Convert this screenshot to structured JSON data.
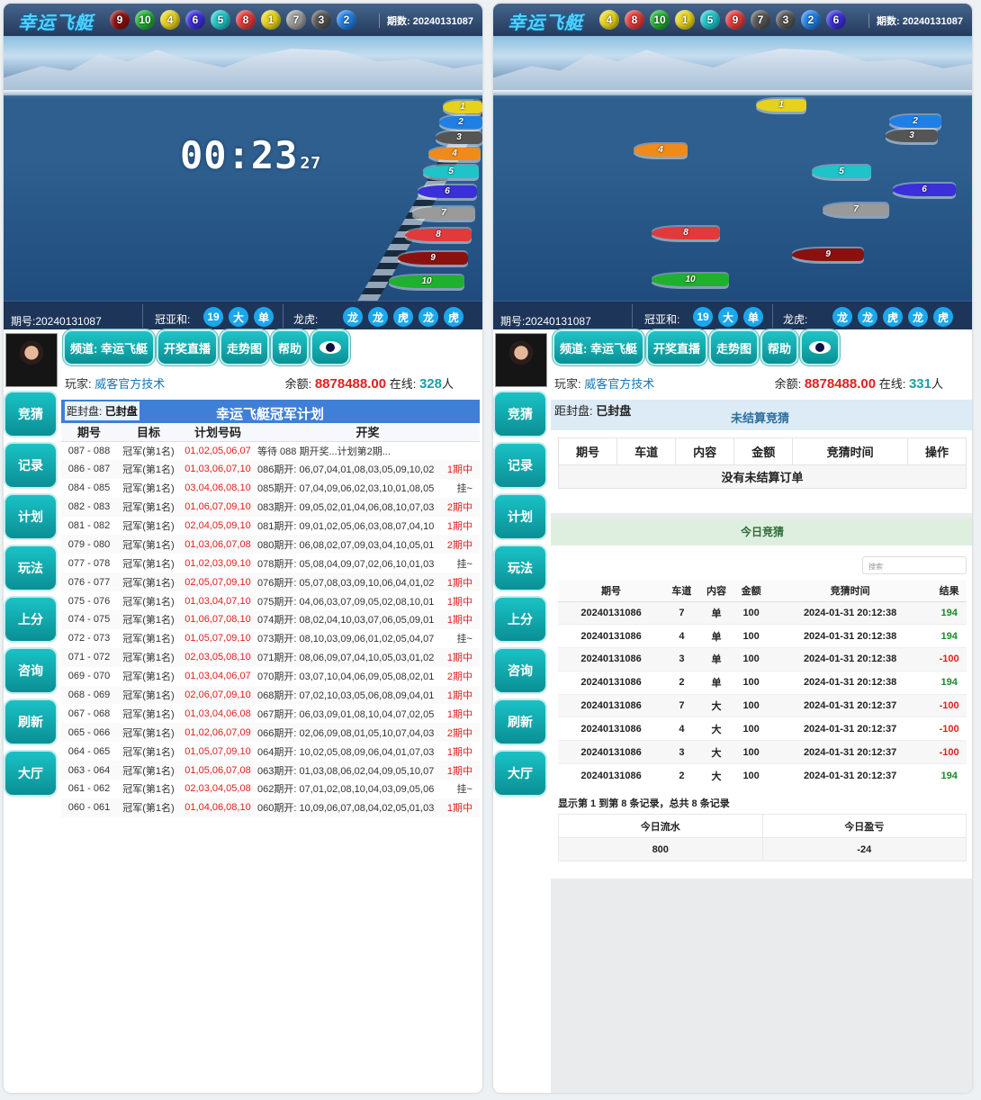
{
  "left": {
    "logo": "幸运飞艇",
    "balls": [
      "9",
      "10",
      "4",
      "6",
      "5",
      "8",
      "1",
      "7",
      "3",
      "2"
    ],
    "issue_label": "期数:",
    "issue": "20240131087",
    "timer": "00:23",
    "timer_ms": "27",
    "boats": [
      "1",
      "2",
      "3",
      "4",
      "5",
      "6",
      "7",
      "8",
      "9",
      "10"
    ],
    "info_issue": "期号:20240131087",
    "gyh_label": "冠亚和:",
    "gyh": [
      "19",
      "大",
      "单"
    ],
    "lh_label": "龙虎:",
    "lh": [
      "龙",
      "龙",
      "虎",
      "龙",
      "虎"
    ],
    "buttons": [
      "频道: 幸运飞艇",
      "开奖直播",
      "走势图",
      "帮助"
    ],
    "player_label": "玩家:",
    "player_name": "威客官方技术",
    "balance_label": "余额:",
    "balance": "8878488.00",
    "online_label": "在线:",
    "online": "328",
    "online_unit": "人",
    "sidenav": [
      "竞猜",
      "记录",
      "计划",
      "玩法",
      "上分",
      "咨询",
      "刷新",
      "大厅"
    ],
    "seal_label": "距封盘:",
    "seal_value": "已封盘",
    "plan_title": "幸运飞艇冠军计划",
    "plan_headers": [
      "期号",
      "目标",
      "计划号码",
      "开奖"
    ],
    "plan_rows": [
      [
        "087 - 088",
        "冠军(第1名)",
        "01,02,05,06,07",
        "等待 088 期开奖...计划第2期...",
        ""
      ],
      [
        "086 - 087",
        "冠军(第1名)",
        "01,03,06,07,10",
        "086期开: 06,07,04,01,08,03,05,09,10,02",
        "1期中"
      ],
      [
        "084 - 085",
        "冠军(第1名)",
        "03,04,06,08,10",
        "085期开: 07,04,09,06,02,03,10,01,08,05",
        "挂~"
      ],
      [
        "082 - 083",
        "冠军(第1名)",
        "01,06,07,09,10",
        "083期开: 09,05,02,01,04,06,08,10,07,03",
        "2期中"
      ],
      [
        "081 - 082",
        "冠军(第1名)",
        "02,04,05,09,10",
        "081期开: 09,01,02,05,06,03,08,07,04,10",
        "1期中"
      ],
      [
        "079 - 080",
        "冠军(第1名)",
        "01,03,06,07,08",
        "080期开: 06,08,02,07,09,03,04,10,05,01",
        "2期中"
      ],
      [
        "077 - 078",
        "冠军(第1名)",
        "01,02,03,09,10",
        "078期开: 05,08,04,09,07,02,06,10,01,03",
        "挂~"
      ],
      [
        "076 - 077",
        "冠军(第1名)",
        "02,05,07,09,10",
        "076期开: 05,07,08,03,09,10,06,04,01,02",
        "1期中"
      ],
      [
        "075 - 076",
        "冠军(第1名)",
        "01,03,04,07,10",
        "075期开: 04,06,03,07,09,05,02,08,10,01",
        "1期中"
      ],
      [
        "074 - 075",
        "冠军(第1名)",
        "01,06,07,08,10",
        "074期开: 08,02,04,10,03,07,06,05,09,01",
        "1期中"
      ],
      [
        "072 - 073",
        "冠军(第1名)",
        "01,05,07,09,10",
        "073期开: 08,10,03,09,06,01,02,05,04,07",
        "挂~"
      ],
      [
        "071 - 072",
        "冠军(第1名)",
        "02,03,05,08,10",
        "071期开: 08,06,09,07,04,10,05,03,01,02",
        "1期中"
      ],
      [
        "069 - 070",
        "冠军(第1名)",
        "01,03,04,06,07",
        "070期开: 03,07,10,04,06,09,05,08,02,01",
        "2期中"
      ],
      [
        "068 - 069",
        "冠军(第1名)",
        "02,06,07,09,10",
        "068期开: 07,02,10,03,05,06,08,09,04,01",
        "1期中"
      ],
      [
        "067 - 068",
        "冠军(第1名)",
        "01,03,04,06,08",
        "067期开: 06,03,09,01,08,10,04,07,02,05",
        "1期中"
      ],
      [
        "065 - 066",
        "冠军(第1名)",
        "01,02,06,07,09",
        "066期开: 02,06,09,08,01,05,10,07,04,03",
        "2期中"
      ],
      [
        "064 - 065",
        "冠军(第1名)",
        "01,05,07,09,10",
        "064期开: 10,02,05,08,09,06,04,01,07,03",
        "1期中"
      ],
      [
        "063 - 064",
        "冠军(第1名)",
        "01,05,06,07,08",
        "063期开: 01,03,08,06,02,04,09,05,10,07",
        "1期中"
      ],
      [
        "061 - 062",
        "冠军(第1名)",
        "02,03,04,05,08",
        "062期开: 07,01,02,08,10,04,03,09,05,06",
        "挂~"
      ],
      [
        "060 - 061",
        "冠军(第1名)",
        "01,04,06,08,10",
        "060期开: 10,09,06,07,08,04,02,05,01,03",
        "1期中"
      ]
    ]
  },
  "right": {
    "logo": "幸运飞艇",
    "balls": [
      "4",
      "8",
      "10",
      "1",
      "5",
      "9",
      "7",
      "3",
      "2",
      "6"
    ],
    "issue_label": "期数:",
    "issue": "20240131087",
    "boats": [
      "1",
      "2",
      "3",
      "4",
      "5",
      "6",
      "7",
      "8",
      "9",
      "10"
    ],
    "info_issue": "期号:20240131087",
    "gyh_label": "冠亚和:",
    "gyh": [
      "19",
      "大",
      "单"
    ],
    "lh_label": "龙虎:",
    "lh": [
      "龙",
      "龙",
      "虎",
      "龙",
      "虎"
    ],
    "buttons": [
      "频道: 幸运飞艇",
      "开奖直播",
      "走势图",
      "帮助"
    ],
    "player_label": "玩家:",
    "player_name": "威客官方技术",
    "balance_label": "余额:",
    "balance": "8878488.00",
    "online_label": "在线:",
    "online": "331",
    "online_unit": "人",
    "sidenav": [
      "竞猜",
      "记录",
      "计划",
      "玩法",
      "上分",
      "咨询",
      "刷新",
      "大厅"
    ],
    "seal_label": "距封盘:",
    "seal_value": "已封盘",
    "pending_title": "未结算竞猜",
    "pending_headers": [
      "期号",
      "车道",
      "内容",
      "金额",
      "竞猜时间",
      "操作"
    ],
    "pending_empty": "没有未结算订单",
    "today_title": "今日竞猜",
    "search_placeholder": "搜索",
    "bet_headers": [
      "期号",
      "车道",
      "内容",
      "金额",
      "竞猜时间",
      "结果"
    ],
    "bets": [
      [
        "20240131086",
        "7",
        "单",
        "100",
        "2024-01-31 20:12:38",
        "194"
      ],
      [
        "20240131086",
        "4",
        "单",
        "100",
        "2024-01-31 20:12:38",
        "194"
      ],
      [
        "20240131086",
        "3",
        "单",
        "100",
        "2024-01-31 20:12:38",
        "-100"
      ],
      [
        "20240131086",
        "2",
        "单",
        "100",
        "2024-01-31 20:12:38",
        "194"
      ],
      [
        "20240131086",
        "7",
        "大",
        "100",
        "2024-01-31 20:12:37",
        "-100"
      ],
      [
        "20240131086",
        "4",
        "大",
        "100",
        "2024-01-31 20:12:37",
        "-100"
      ],
      [
        "20240131086",
        "3",
        "大",
        "100",
        "2024-01-31 20:12:37",
        "-100"
      ],
      [
        "20240131086",
        "2",
        "大",
        "100",
        "2024-01-31 20:12:37",
        "194"
      ]
    ],
    "summary_note": "显示第 1 到第 8 条记录，总共 8 条记录",
    "totals_headers": [
      "今日流水",
      "今日盈亏"
    ],
    "totals": [
      "800",
      "-24"
    ]
  },
  "colors": {
    "teal_button": "#0fa9ad",
    "accent_blue": "#3f7fd8",
    "win": "#1a8a2a",
    "loss": "#e02020"
  }
}
